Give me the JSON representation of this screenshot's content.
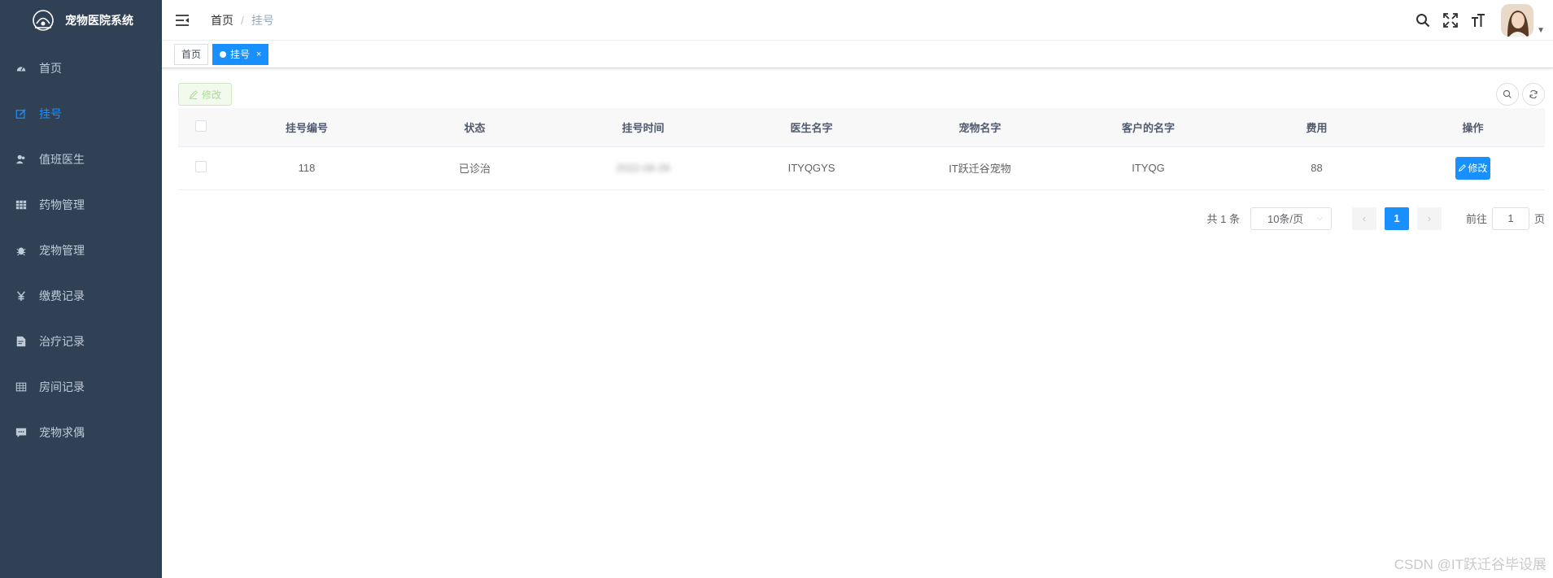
{
  "app": {
    "title": "宠物医院系统"
  },
  "sidebar": {
    "items": [
      {
        "label": "首页",
        "icon": "dashboard-icon",
        "active": false
      },
      {
        "label": "挂号",
        "icon": "edit-icon",
        "active": true
      },
      {
        "label": "值班医生",
        "icon": "peoples-icon",
        "active": false
      },
      {
        "label": "药物管理",
        "icon": "grid-icon",
        "active": false
      },
      {
        "label": "宠物管理",
        "icon": "bug-icon",
        "active": false
      },
      {
        "label": "缴费记录",
        "icon": "yen-icon",
        "active": false
      },
      {
        "label": "治疗记录",
        "icon": "documentation-icon",
        "active": false
      },
      {
        "label": "房间记录",
        "icon": "table-icon",
        "active": false
      },
      {
        "label": "宠物求偶",
        "icon": "message-icon",
        "active": false
      }
    ]
  },
  "navbar": {
    "breadcrumb": {
      "home": "首页",
      "separator": "/",
      "current": "挂号"
    }
  },
  "tags": {
    "home": "首页",
    "current": "挂号",
    "close": "×"
  },
  "toolbar": {
    "edit_label": "修改"
  },
  "table": {
    "columns": [
      "挂号编号",
      "状态",
      "挂号时间",
      "医生名字",
      "宠物名字",
      "客户的名字",
      "费用",
      "操作"
    ],
    "rows": [
      {
        "id": "118",
        "status": "已诊治",
        "time": "2022-06-26",
        "doctor": "ITYQGYS",
        "pet": "IT跃迁谷宠物",
        "customer": "ITYQG",
        "fee": "88",
        "action": "修改"
      }
    ]
  },
  "pagination": {
    "total": "共 1 条",
    "page_size": "10条/页",
    "current_page": "1",
    "jump_prefix": "前往",
    "jump_value": "1",
    "jump_suffix": "页"
  },
  "watermark": "CSDN @IT跃迁谷毕设展",
  "colors": {
    "sidebar_bg": "#304156",
    "primary": "#1890ff",
    "sidebar_text": "#bfcbd9"
  }
}
